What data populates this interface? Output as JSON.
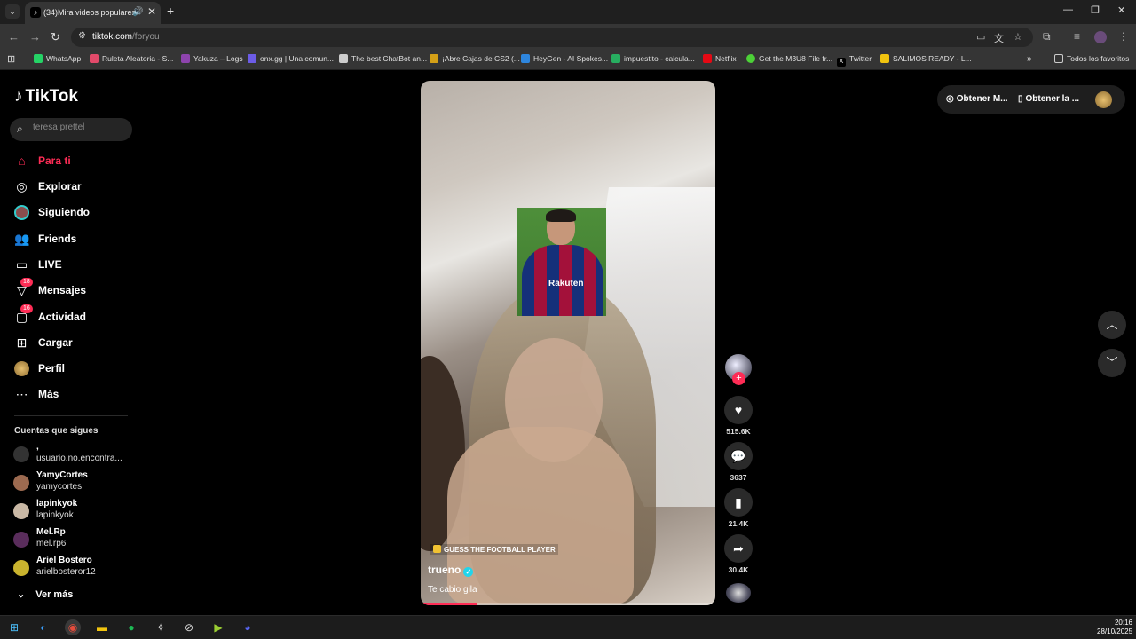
{
  "browser": {
    "tab_title": "(34)Mira videos populares",
    "url_host": "tiktok.com",
    "url_path": "/foryou",
    "bookmarks": [
      {
        "label": "WhatsApp",
        "icon": "whatsapp-icon",
        "color": "#25d366"
      },
      {
        "label": "Ruleta Aleatoria - S...",
        "icon": "ruleta-icon",
        "color": "#e24a6a"
      },
      {
        "label": "Yakuza – Logs",
        "icon": "yakuza-icon",
        "color": "#8e44ad"
      },
      {
        "label": "onx.gg | Una comun...",
        "icon": "onx-icon",
        "color": "#6c5ce7"
      },
      {
        "label": "The best ChatBot an...",
        "icon": "chatbot-icon",
        "color": "#cccccc"
      },
      {
        "label": "¡Abre Cajas de CS2 (...",
        "icon": "cs2-icon",
        "color": "#d4a017"
      },
      {
        "label": "HeyGen - AI Spokes...",
        "icon": "heygen-icon",
        "color": "#2e86de"
      },
      {
        "label": "impuestito - calcula...",
        "icon": "impuestito-icon",
        "color": "#27ae60"
      },
      {
        "label": "Netflix",
        "icon": "netflix-icon",
        "color": "#e50914"
      },
      {
        "label": "Get the M3U8 File fr...",
        "icon": "m3u8-icon",
        "color": "#4cd137"
      },
      {
        "label": "Twitter",
        "icon": "x-icon",
        "color": "#000000"
      },
      {
        "label": "SALIMOS READY - L...",
        "icon": "salimos-icon",
        "color": "#f1c40f"
      }
    ],
    "all_bookmarks": "Todos los favoritos"
  },
  "sidebar": {
    "brand": "TikTok",
    "search_placeholder": "teresa prettel",
    "nav": [
      {
        "label": "Para ti",
        "icon": "home-icon",
        "active": true
      },
      {
        "label": "Explorar",
        "icon": "compass-icon"
      },
      {
        "label": "Siguiendo",
        "icon": "following-icon"
      },
      {
        "label": "Friends",
        "icon": "friends-icon"
      },
      {
        "label": "LIVE",
        "icon": "live-icon"
      },
      {
        "label": "Mensajes",
        "icon": "messages-icon",
        "badge": "18"
      },
      {
        "label": "Actividad",
        "icon": "activity-icon",
        "badge": "16"
      },
      {
        "label": "Cargar",
        "icon": "upload-icon"
      },
      {
        "label": "Perfil",
        "icon": "profile-icon"
      },
      {
        "label": "Más",
        "icon": "more-icon"
      }
    ],
    "following_title": "Cuentas que sigues",
    "accounts": [
      {
        "name": ",",
        "handle": "usuario.no.encontra..."
      },
      {
        "name": "YamyCortes",
        "handle": "yamycortes"
      },
      {
        "name": "lapinkyok",
        "handle": "lapinkyok"
      },
      {
        "name": "Mel.Rp",
        "handle": "mel.rp6"
      },
      {
        "name": "Ariel Bostero",
        "handle": "arielbosteror12"
      }
    ],
    "see_more": "Ver más"
  },
  "video": {
    "tag": "GUESS THE FOOTBALL PLAYER",
    "author": "trueno",
    "description": "Te cabio gila",
    "sponsor": "Rakuten",
    "progress": 0.19,
    "likes": "515.6K",
    "comments": "3637",
    "saves": "21.4K",
    "shares": "30.4K"
  },
  "header": {
    "get_btn_1": "Obtener M...",
    "get_btn_2": "Obtener la ..."
  },
  "taskbar": {
    "time": "20:16",
    "date": "28/10/2025"
  },
  "colors": {
    "accent": "#fe2c55",
    "background": "#000000"
  }
}
